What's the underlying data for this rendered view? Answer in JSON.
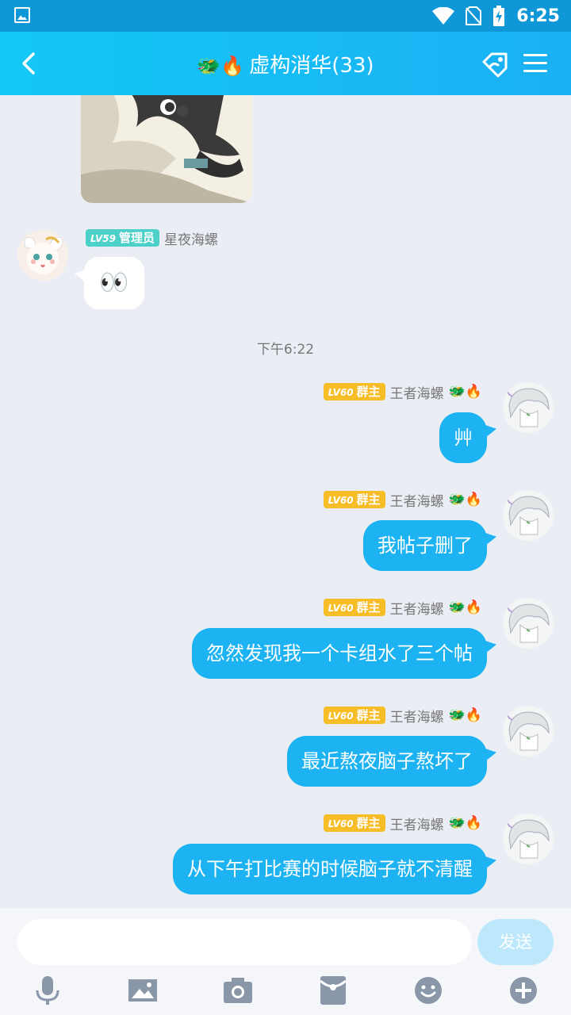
{
  "status_bar": {
    "time": "6:25"
  },
  "header": {
    "emojis": "🐲🔥",
    "title": "虚构消华(33)"
  },
  "messages": [
    {
      "sender": "星夜海螺",
      "level": "LV59",
      "role": "管理员",
      "text": "👀"
    },
    {
      "timestamp": "下午6:22"
    },
    {
      "sender": "王者海螺",
      "level": "LV60",
      "role": "群主",
      "emojis": "🐲🔥",
      "text": "艸"
    },
    {
      "sender": "王者海螺",
      "level": "LV60",
      "role": "群主",
      "emojis": "🐲🔥",
      "text": "我帖子删了"
    },
    {
      "sender": "王者海螺",
      "level": "LV60",
      "role": "群主",
      "emojis": "🐲🔥",
      "text": "忽然发现我一个卡组水了三个帖"
    },
    {
      "sender": "王者海螺",
      "level": "LV60",
      "role": "群主",
      "emojis": "🐲🔥",
      "text": "最近熬夜脑子熬坏了"
    },
    {
      "sender": "王者海螺",
      "level": "LV60",
      "role": "群主",
      "emojis": "🐲🔥",
      "text": "从下午打比赛的时候脑子就不清醒"
    }
  ],
  "input": {
    "value": "",
    "send_label": "发送"
  },
  "toolbar_icons": [
    "microphone-icon",
    "image-icon",
    "camera-icon",
    "red-packet-icon",
    "emoji-icon",
    "plus-icon"
  ],
  "colors": {
    "header_start": "#13c8f7",
    "header_end": "#1ab0f3",
    "bubble_self": "#1db3f2",
    "badge_owner": "#f7bd27",
    "badge_admin": "#4dd0c7",
    "chat_bg": "#eaedf4"
  }
}
